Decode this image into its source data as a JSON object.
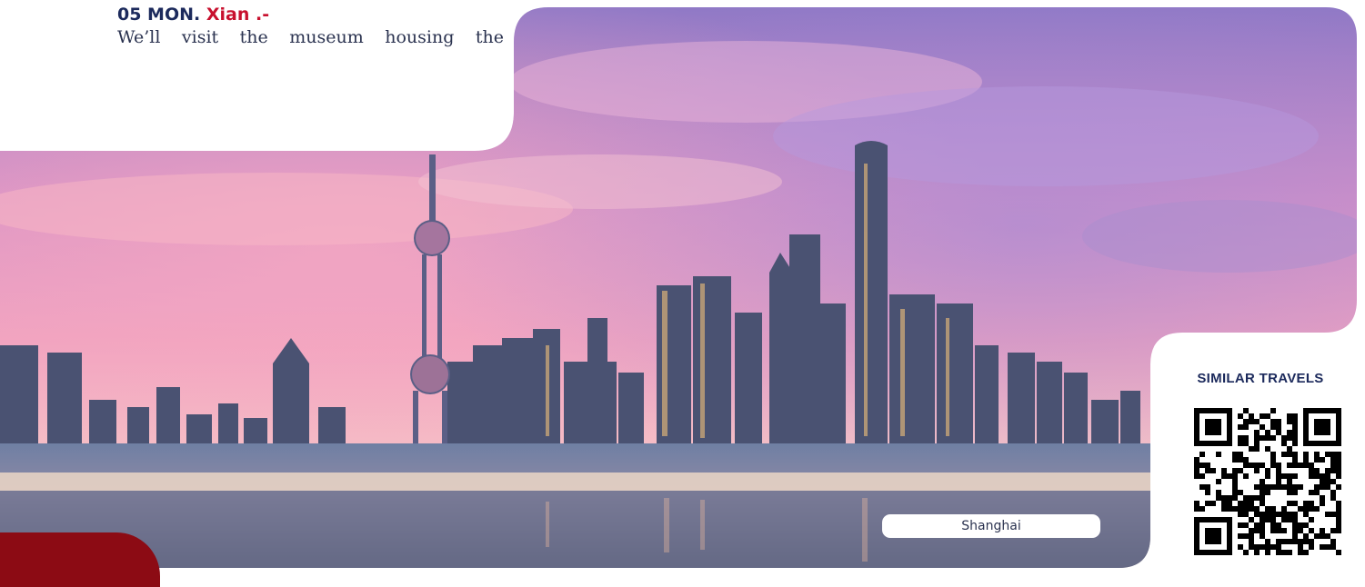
{
  "itinerary": {
    "day_label": "05 MON.",
    "city": "Xian .-",
    "text": "We’ll visit the museum housing the"
  },
  "photo": {
    "caption": "Shanghai"
  },
  "similar_travels": {
    "label": "SIMILAR TRAVELS"
  },
  "colors": {
    "navy": "#1c2a5c",
    "accent_red": "#c8102e",
    "tab_red": "#8c0b14"
  }
}
